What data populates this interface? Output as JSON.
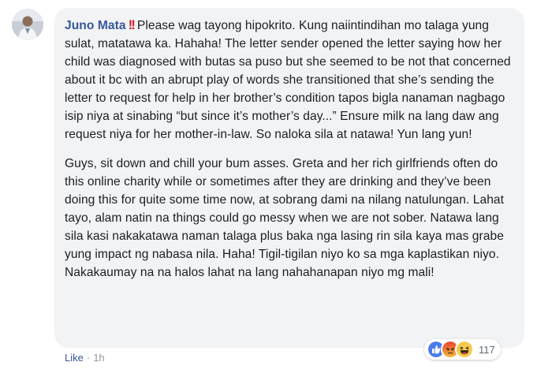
{
  "comment": {
    "author": "Juno Mata",
    "emoji": "!!",
    "paragraphs": [
      "Please wag tayong hipokrito. Kung naiintindihan mo talaga yung sulat, matatawa ka. Hahaha! The letter sender opened the letter saying how her child was diagnosed with butas sa puso but she seemed to be not that concerned about it bc with an abrupt play of words she transitioned that she’s sending the letter to request for help in her brother’s condition tapos bigla nanaman nagbago isip niya at sinabing “but since it’s mother’s day...” Ensure milk na lang daw ang request niya for her mother-in-law. So naloka sila at natawa! Yun lang yun!",
      "Guys, sit down and chill your bum asses. Greta and her rich girlfriends often do this online charity while or sometimes after they are drinking and they’ve been doing this for quite some time now, at sobrang dami na nilang natulungan. Lahat tayo, alam natin na things could go messy when we are not sober. Natawa lang sila kasi nakakatawa naman talaga plus baka nga lasing rin sila kaya mas grabe yung impact ng nabasa nila. Haha! Tigil-tigilan niyo ko sa mga kaplastikan niyo. Nakakaumay na na halos lahat na lang nahahanapan niyo mg mali!"
    ]
  },
  "reactions": {
    "icons": [
      "like-icon",
      "angry-icon",
      "haha-icon"
    ],
    "count": "117"
  },
  "footer": {
    "like_label": "Like",
    "separator": "·",
    "time": "1h"
  },
  "colors": {
    "author": "#365899",
    "bubble": "#f2f3f5",
    "text": "#1c1e21",
    "like_blue": "#4b7bec",
    "angry_red": "#e9710f",
    "haha_yellow": "#f7c94b"
  }
}
